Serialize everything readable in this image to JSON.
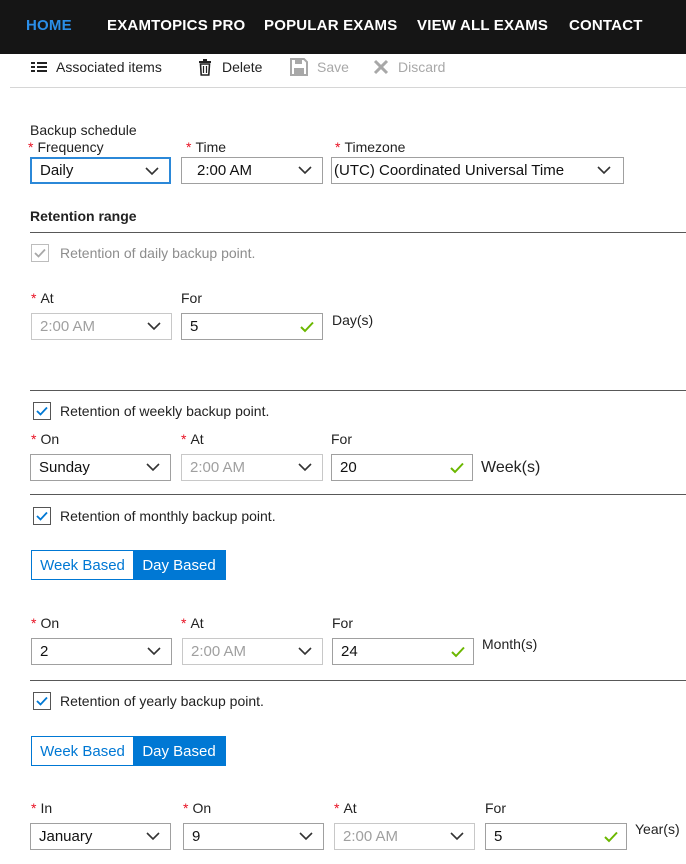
{
  "nav": {
    "items": [
      "HOME",
      "EXAMTOPICS PRO",
      "POPULAR EXAMS",
      "VIEW ALL EXAMS",
      "CONTACT"
    ],
    "active_color": "#2a8ee8"
  },
  "toolbar": {
    "associated_label": "Associated items",
    "delete_label": "Delete",
    "save_label": "Save",
    "discard_label": "Discard"
  },
  "schedule": {
    "title": "Backup schedule",
    "frequency_label": "Frequency",
    "frequency_value": "Daily",
    "time_label": "Time",
    "time_value": "2:00 AM",
    "timezone_label": "Timezone",
    "timezone_value": "(UTC) Coordinated Universal Time"
  },
  "retention": {
    "title": "Retention range",
    "daily": {
      "label": "Retention of daily backup point.",
      "checked": true,
      "at_label": "At",
      "at_value": "2:00 AM",
      "for_label": "For",
      "for_value": "5",
      "unit": "Day(s)"
    },
    "weekly": {
      "label": "Retention of weekly backup point.",
      "checked": true,
      "on_label": "On",
      "on_value": "Sunday",
      "at_label": "At",
      "at_value": "2:00 AM",
      "for_label": "For",
      "for_value": "20",
      "unit": "Week(s)"
    },
    "monthly": {
      "label": "Retention of monthly backup point.",
      "checked": true,
      "week_based": "Week Based",
      "day_based": "Day Based",
      "on_label": "On",
      "on_value": "2",
      "at_label": "At",
      "at_value": "2:00 AM",
      "for_label": "For",
      "for_value": "24",
      "unit": "Month(s)"
    },
    "yearly": {
      "label": "Retention of yearly backup point.",
      "checked": true,
      "week_based": "Week Based",
      "day_based": "Day Based",
      "in_label": "In",
      "in_value": "January",
      "on_label": "On",
      "on_value": "9",
      "at_label": "At",
      "at_value": "2:00 AM",
      "for_label": "For",
      "for_value": "5",
      "unit": "Year(s)"
    }
  },
  "colors": {
    "accent": "#0078d4",
    "required": "#e81123",
    "valid_check": "#6bb700",
    "nav_bg": "#151515"
  },
  "icons": {
    "associated": "list-icon",
    "delete": "trash-icon",
    "save": "save-icon",
    "discard": "close-icon",
    "dropdown": "chevron-down-icon",
    "valid": "checkmark-icon"
  }
}
